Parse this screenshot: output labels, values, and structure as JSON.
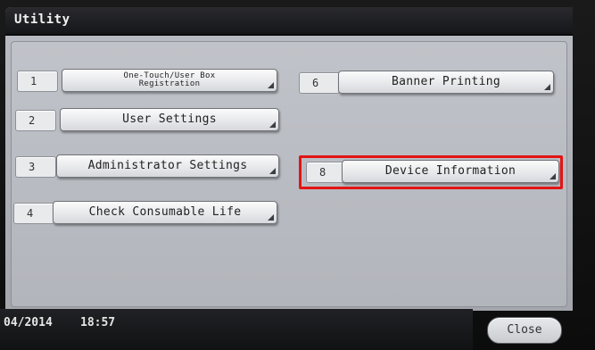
{
  "window": {
    "title": "Utility"
  },
  "menu": {
    "items": [
      {
        "number": "1",
        "label_line1": "One-Touch/User Box",
        "label_line2": "Registration"
      },
      {
        "number": "2",
        "label": "User Settings"
      },
      {
        "number": "3",
        "label": "Administrator Settings"
      },
      {
        "number": "4",
        "label": "Check Consumable Life"
      },
      {
        "number": "6",
        "label": "Banner Printing"
      },
      {
        "number": "8",
        "label": "Device Information"
      }
    ]
  },
  "status_bar": {
    "date": "04/2014",
    "time": "18:57"
  },
  "footer": {
    "close_label": "Close"
  },
  "colors": {
    "highlight": "#e21414"
  }
}
